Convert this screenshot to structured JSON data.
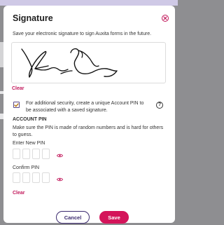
{
  "dialog": {
    "title": "Signature",
    "subtitle": "Save your electronic signature to sign Auxita forms in the future.",
    "close_icon": "close-circle-icon",
    "signature_clear_label": "Clear",
    "security_checkbox_checked": true,
    "security_text": "For additional security, create a unique Account PIN to be associated with a saved signature.",
    "help_icon": "question-circle-icon",
    "help_glyph": "?",
    "account_pin": {
      "heading": "ACCOUNT PIN",
      "help_text": "Make sure the PIN is made of random numbers and is hard for others to guess.",
      "new_pin_label": "Enter New PIN",
      "confirm_pin_label": "Confirm PIN",
      "reveal_icon": "eye-icon",
      "clear_label": "Clear"
    },
    "buttons": {
      "cancel_label": "Cancel",
      "save_label": "Save"
    }
  },
  "colors": {
    "accent": "#c2185b",
    "primary_button": "#d4145a",
    "secondary_outline": "#3b2a6e",
    "overlay": "#8e8e91"
  }
}
